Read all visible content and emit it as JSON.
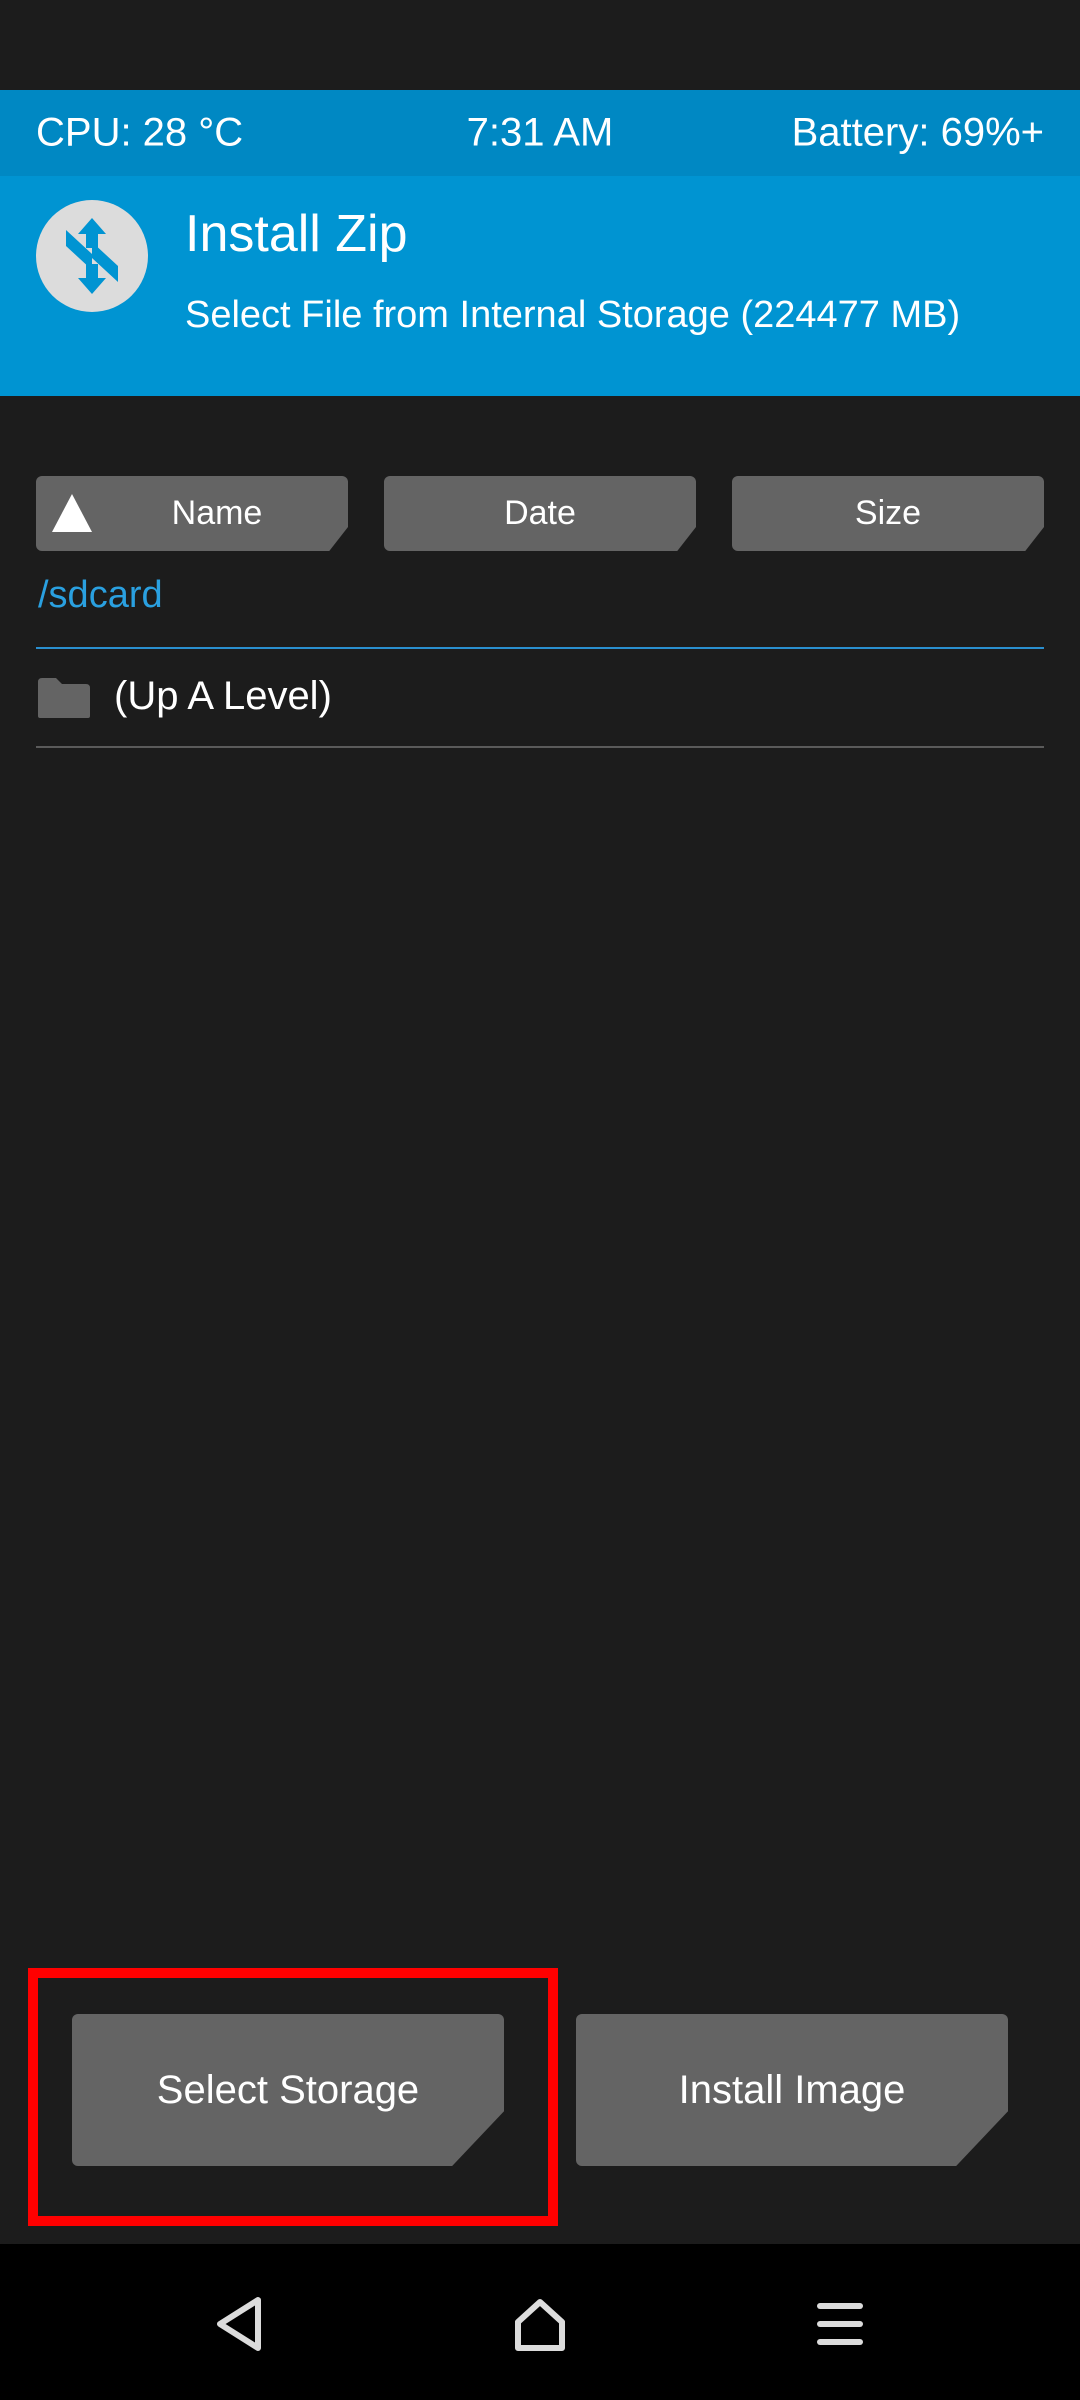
{
  "status_bar": {
    "cpu": "CPU: 28 °C",
    "time": "7:31 AM",
    "battery": "Battery: 69%+"
  },
  "header": {
    "title": "Install Zip",
    "subtitle": "Select File from Internal Storage (224477 MB)"
  },
  "sort_buttons": {
    "name": "Name",
    "date": "Date",
    "size": "Size"
  },
  "file_browser": {
    "path": "/sdcard",
    "items": [
      {
        "label": "(Up A Level)",
        "icon": "folder-icon"
      }
    ]
  },
  "actions": {
    "select_storage": "Select Storage",
    "install_image": "Install Image"
  },
  "colors": {
    "background": "#1c1c1c",
    "status_bar": "#0088c3",
    "header": "#0094d2",
    "button": "#646464",
    "path_text": "#2aa0e0",
    "highlight": "#ff0000"
  },
  "nav_icons": [
    "back-icon",
    "home-icon",
    "menu-icon"
  ]
}
